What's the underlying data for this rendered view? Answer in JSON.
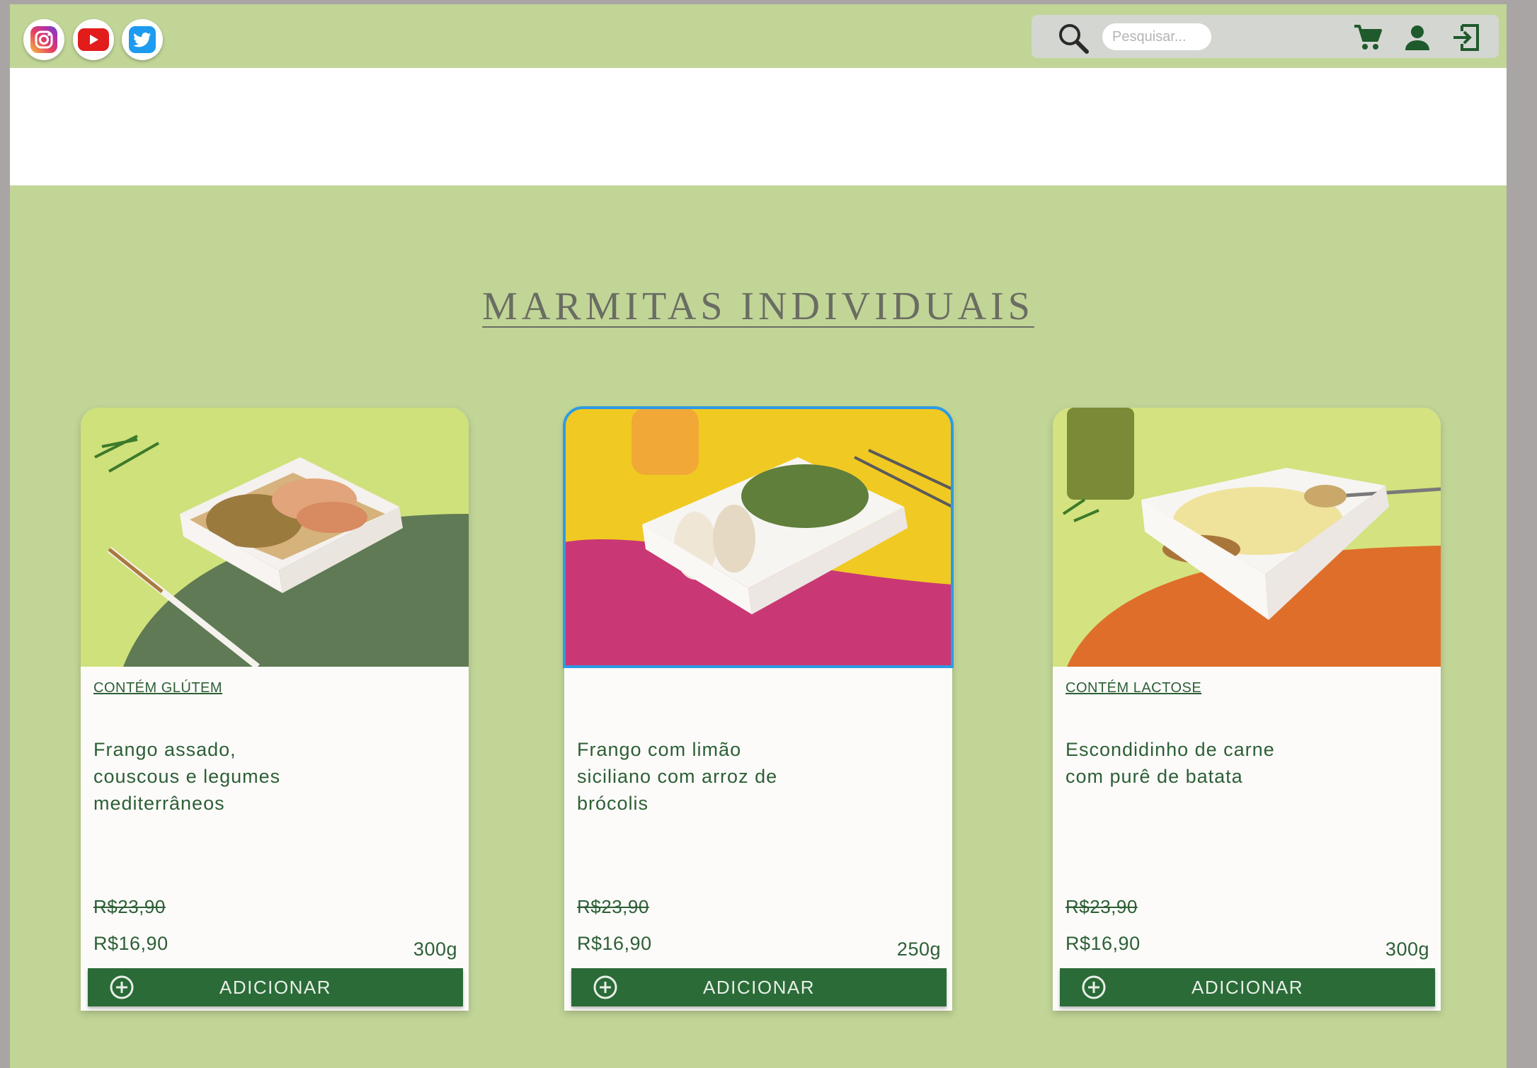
{
  "header": {
    "social": [
      {
        "icon": "instagram-icon"
      },
      {
        "icon": "youtube-icon"
      },
      {
        "icon": "twitter-icon"
      }
    ],
    "search": {
      "placeholder": "Pesquisar...",
      "icon": "search-icon"
    },
    "tools": {
      "cart_icon": "cart-icon",
      "user_icon": "user-icon",
      "login_icon": "login-icon"
    }
  },
  "section": {
    "title": "MARMITAS INDIVIDUAIS"
  },
  "products": [
    {
      "tag": "CONTÉM GLÚTEM",
      "name": "Frango assado, couscous e legumes mediterrâneos",
      "old_price": "R$23,90",
      "price": "R$16,90",
      "weight": "300g",
      "button": "ADICIONAR"
    },
    {
      "tag": "",
      "name": "Frango com limão siciliano com arroz de brócolis",
      "old_price": "R$23,90",
      "price": "R$16,90",
      "weight": "250g",
      "button": "ADICIONAR"
    },
    {
      "tag": "CONTÉM LACTOSE",
      "name": "Escondidinho de carne com purê de batata",
      "old_price": "R$23,90",
      "price": "R$16,90",
      "weight": "300g",
      "button": "ADICIONAR"
    }
  ],
  "colors": {
    "page_green": "#c1d597",
    "button_green": "#2a6b38",
    "text_green": "#2d5f35",
    "selected_outline": "#2d9be4"
  }
}
